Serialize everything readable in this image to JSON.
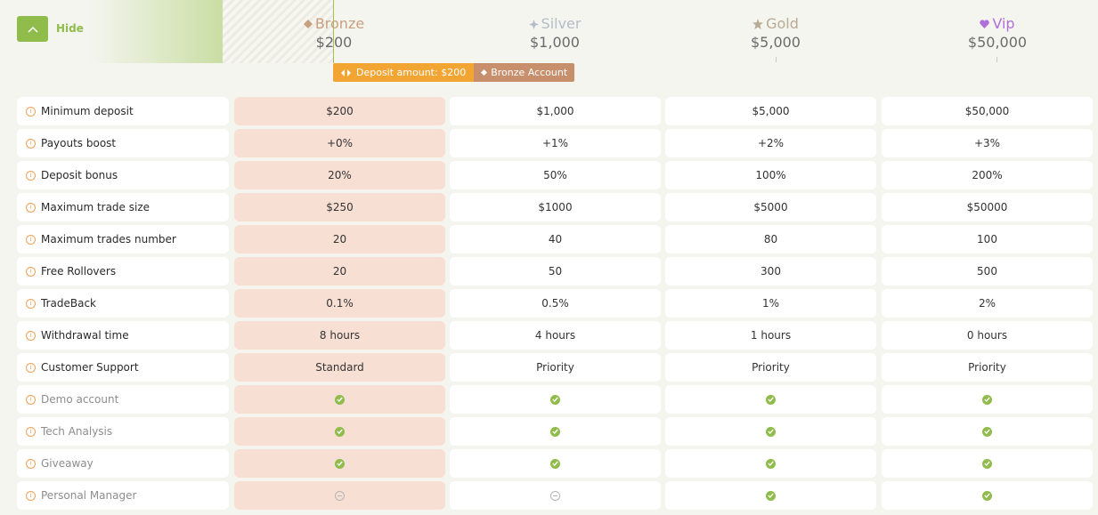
{
  "toggle": {
    "label": "Hide"
  },
  "tiers": [
    {
      "name": "Bronze",
      "price": "$200",
      "color": "#c8a080",
      "icon": "diamond-icon"
    },
    {
      "name": "Silver",
      "price": "$1,000",
      "color": "#b4bcc8",
      "icon": "plus-star-icon"
    },
    {
      "name": "Gold",
      "price": "$5,000",
      "color": "#b8aa94",
      "icon": "star-icon"
    },
    {
      "name": "Vip",
      "price": "$50,000",
      "color": "#b070d8",
      "icon": "heart-icon"
    }
  ],
  "deposit": {
    "label": "Deposit amount: $200",
    "account": "Bronze Account"
  },
  "rows": [
    {
      "label": "Minimum deposit",
      "values": [
        "$200",
        "$1,000",
        "$5,000",
        "$50,000"
      ]
    },
    {
      "label": "Payouts boost",
      "values": [
        "+0%",
        "+1%",
        "+2%",
        "+3%"
      ]
    },
    {
      "label": "Deposit bonus",
      "values": [
        "20%",
        "50%",
        "100%",
        "200%"
      ]
    },
    {
      "label": "Maximum trade size",
      "values": [
        "$250",
        "$1000",
        "$5000",
        "$50000"
      ]
    },
    {
      "label": "Maximum trades number",
      "values": [
        "20",
        "40",
        "80",
        "100"
      ]
    },
    {
      "label": "Free Rollovers",
      "values": [
        "20",
        "50",
        "300",
        "500"
      ]
    },
    {
      "label": "TradeBack",
      "values": [
        "0.1%",
        "0.5%",
        "1%",
        "2%"
      ]
    },
    {
      "label": "Withdrawal time",
      "values": [
        "8 hours",
        "4 hours",
        "1 hours",
        "0 hours"
      ]
    },
    {
      "label": "Customer Support",
      "values": [
        "Standard",
        "Priority",
        "Priority",
        "Priority"
      ]
    }
  ],
  "features": [
    {
      "label": "Demo account",
      "values": [
        true,
        true,
        true,
        true
      ]
    },
    {
      "label": "Tech Analysis",
      "values": [
        true,
        true,
        true,
        true
      ]
    },
    {
      "label": "Giveaway",
      "values": [
        true,
        true,
        true,
        true
      ]
    },
    {
      "label": "Personal Manager",
      "values": [
        false,
        false,
        true,
        true
      ]
    }
  ],
  "colors": {
    "accent": "#8fbc4a",
    "selected_column": "#f8dfd3",
    "deposit_pill": "#f3a534",
    "account_pill": "#c88f6c"
  }
}
